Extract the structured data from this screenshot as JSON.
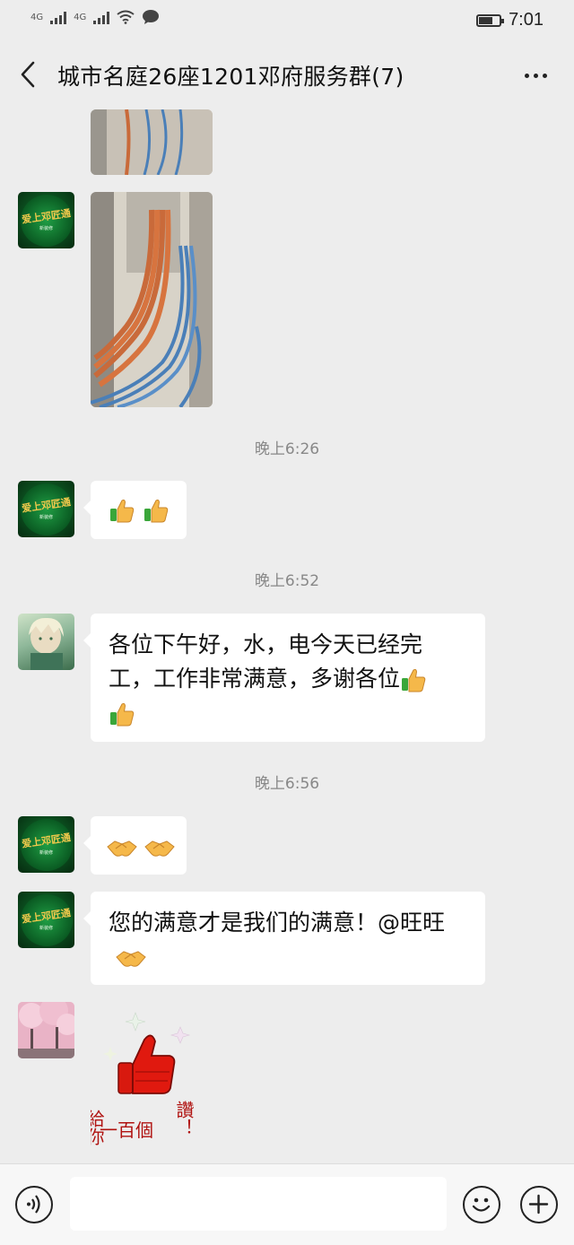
{
  "status_bar": {
    "network_1": "4G",
    "network_2": "4G",
    "time": "7:01",
    "battery_level": 0.7
  },
  "header": {
    "back_icon": "chevron-left-icon",
    "title": "城市名庭26座1201邓府服务群(7)",
    "more_icon": "more-dots-icon"
  },
  "messages": {
    "t1": "晚上6:26",
    "t2": "晚上6:52",
    "t3": "晚上6:56",
    "m3_line1": "各位下午好，水，电今天已经完",
    "m3_line2": "工，工作非常满意，多谢各位",
    "m4_text": "您的满意才是我们的满意！@旺旺",
    "brand_logo": "爱上邓匠通",
    "brand_sub": "新装修"
  },
  "sticker": {
    "text_left": "給你",
    "text_bottom": "一百個",
    "text_right": "讚！"
  },
  "input_bar": {
    "voice_icon": "voice-icon",
    "emoji_icon": "emoji-icon",
    "plus_icon": "plus-icon"
  }
}
